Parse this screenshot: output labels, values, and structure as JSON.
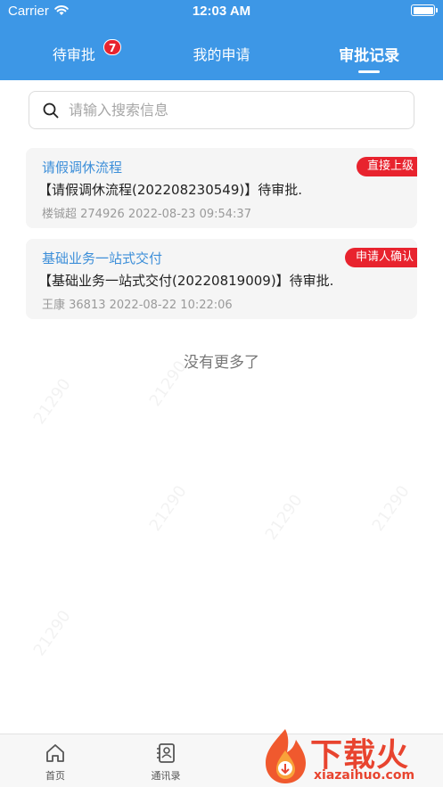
{
  "status_bar": {
    "carrier": "Carrier",
    "time": "12:03 AM"
  },
  "tabs": [
    {
      "label": "待审批",
      "badge": "7"
    },
    {
      "label": "我的申请"
    },
    {
      "label": "审批记录"
    }
  ],
  "search": {
    "placeholder": "请输入搜索信息"
  },
  "records": [
    {
      "title": "请假调休流程",
      "desc": "【请假调休流程(202208230549)】待审批.",
      "meta": "楼铖超 274926 2022-08-23 09:54:37",
      "tag": "直接上级"
    },
    {
      "title": "基础业务一站式交付",
      "desc": "【基础业务一站式交付(20220819009)】待审批.",
      "meta": "王康 36813 2022-08-22 10:22:06",
      "tag": "申请人确认"
    }
  ],
  "no_more": "没有更多了",
  "tabbar": [
    {
      "label": "首页",
      "icon": "home-icon"
    },
    {
      "label": "通讯录",
      "icon": "contacts-icon"
    }
  ],
  "watermark": {
    "logo_cn": "下载火",
    "logo_en": "xiazaihuo.com",
    "text": "21290"
  },
  "colors": {
    "primary": "#3d97e6",
    "badge_red": "#e8232e",
    "link_blue": "#3d8fd9"
  }
}
